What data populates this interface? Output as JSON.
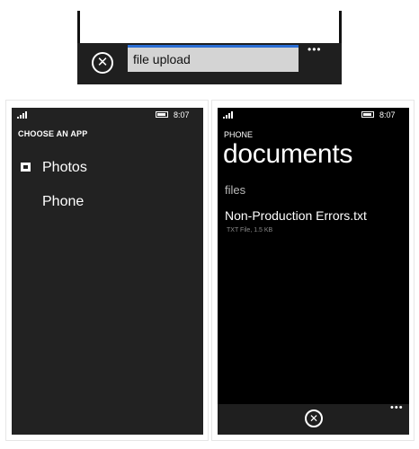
{
  "upload_bar": {
    "field_value": "file upload",
    "close_icon": "close-circle-icon",
    "more_icon": "ellipsis-icon",
    "more_glyph": "•••",
    "progress_color": "#2c6fd6"
  },
  "chooser": {
    "status": {
      "time": "8:07"
    },
    "title": "CHOOSE AN APP",
    "apps": [
      {
        "label": "Photos",
        "icon": "photos-icon"
      },
      {
        "label": "Phone"
      }
    ]
  },
  "documents": {
    "status": {
      "time": "8:07"
    },
    "location_label": "PHONE",
    "title": "documents",
    "section_header": "files",
    "files": [
      {
        "name": "Non-Production Errors.txt",
        "meta": "TXT File, 1.5 KB"
      }
    ],
    "appbar": {
      "close_icon": "close-circle-icon",
      "more_icon": "ellipsis-icon",
      "more_glyph": "•••"
    }
  }
}
